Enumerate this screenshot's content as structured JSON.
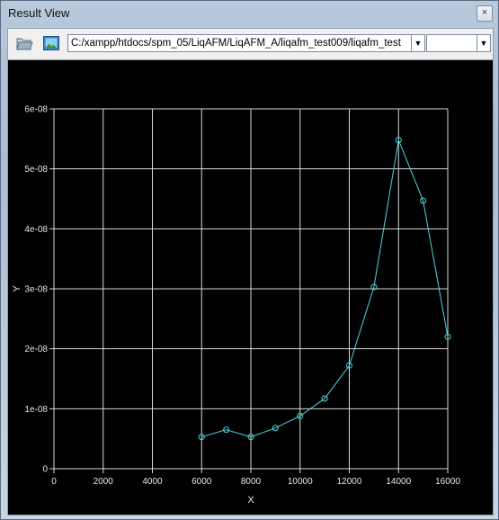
{
  "window": {
    "title": "Result View",
    "close_glyph": "×"
  },
  "toolbar": {
    "open_icon": "folder-open-icon",
    "image_icon": "image-icon",
    "path_value": "C:/xampp/htdocs/spm_05/LiqAFM/LiqAFM_A/liqafm_test009/liqafm_test",
    "dropdown_glyph": "▼",
    "secondary_combo_value": ""
  },
  "chart_data": {
    "type": "line",
    "xlabel": "X",
    "ylabel": "Y",
    "xlim": [
      0,
      16000
    ],
    "ylim": [
      0,
      6e-08
    ],
    "x_ticks": [
      "0",
      "2000",
      "4000",
      "6000",
      "8000",
      "10000",
      "12000",
      "14000",
      "16000"
    ],
    "y_ticks": [
      "0",
      "1e-08",
      "2e-08",
      "3e-08",
      "4e-08",
      "5e-08",
      "6e-08"
    ],
    "grid": true,
    "line_color": "#4fd6e0",
    "series": [
      {
        "x": [
          6000,
          7000,
          8000,
          9000,
          10000,
          11000,
          12000,
          13000,
          14000,
          15000,
          16000
        ],
        "y": [
          5.3e-09,
          6.5e-09,
          5.3e-09,
          6.8e-09,
          8.8e-09,
          1.17e-08,
          1.72e-08,
          3.03e-08,
          5.48e-08,
          4.47e-08,
          2.2e-08
        ]
      }
    ]
  }
}
